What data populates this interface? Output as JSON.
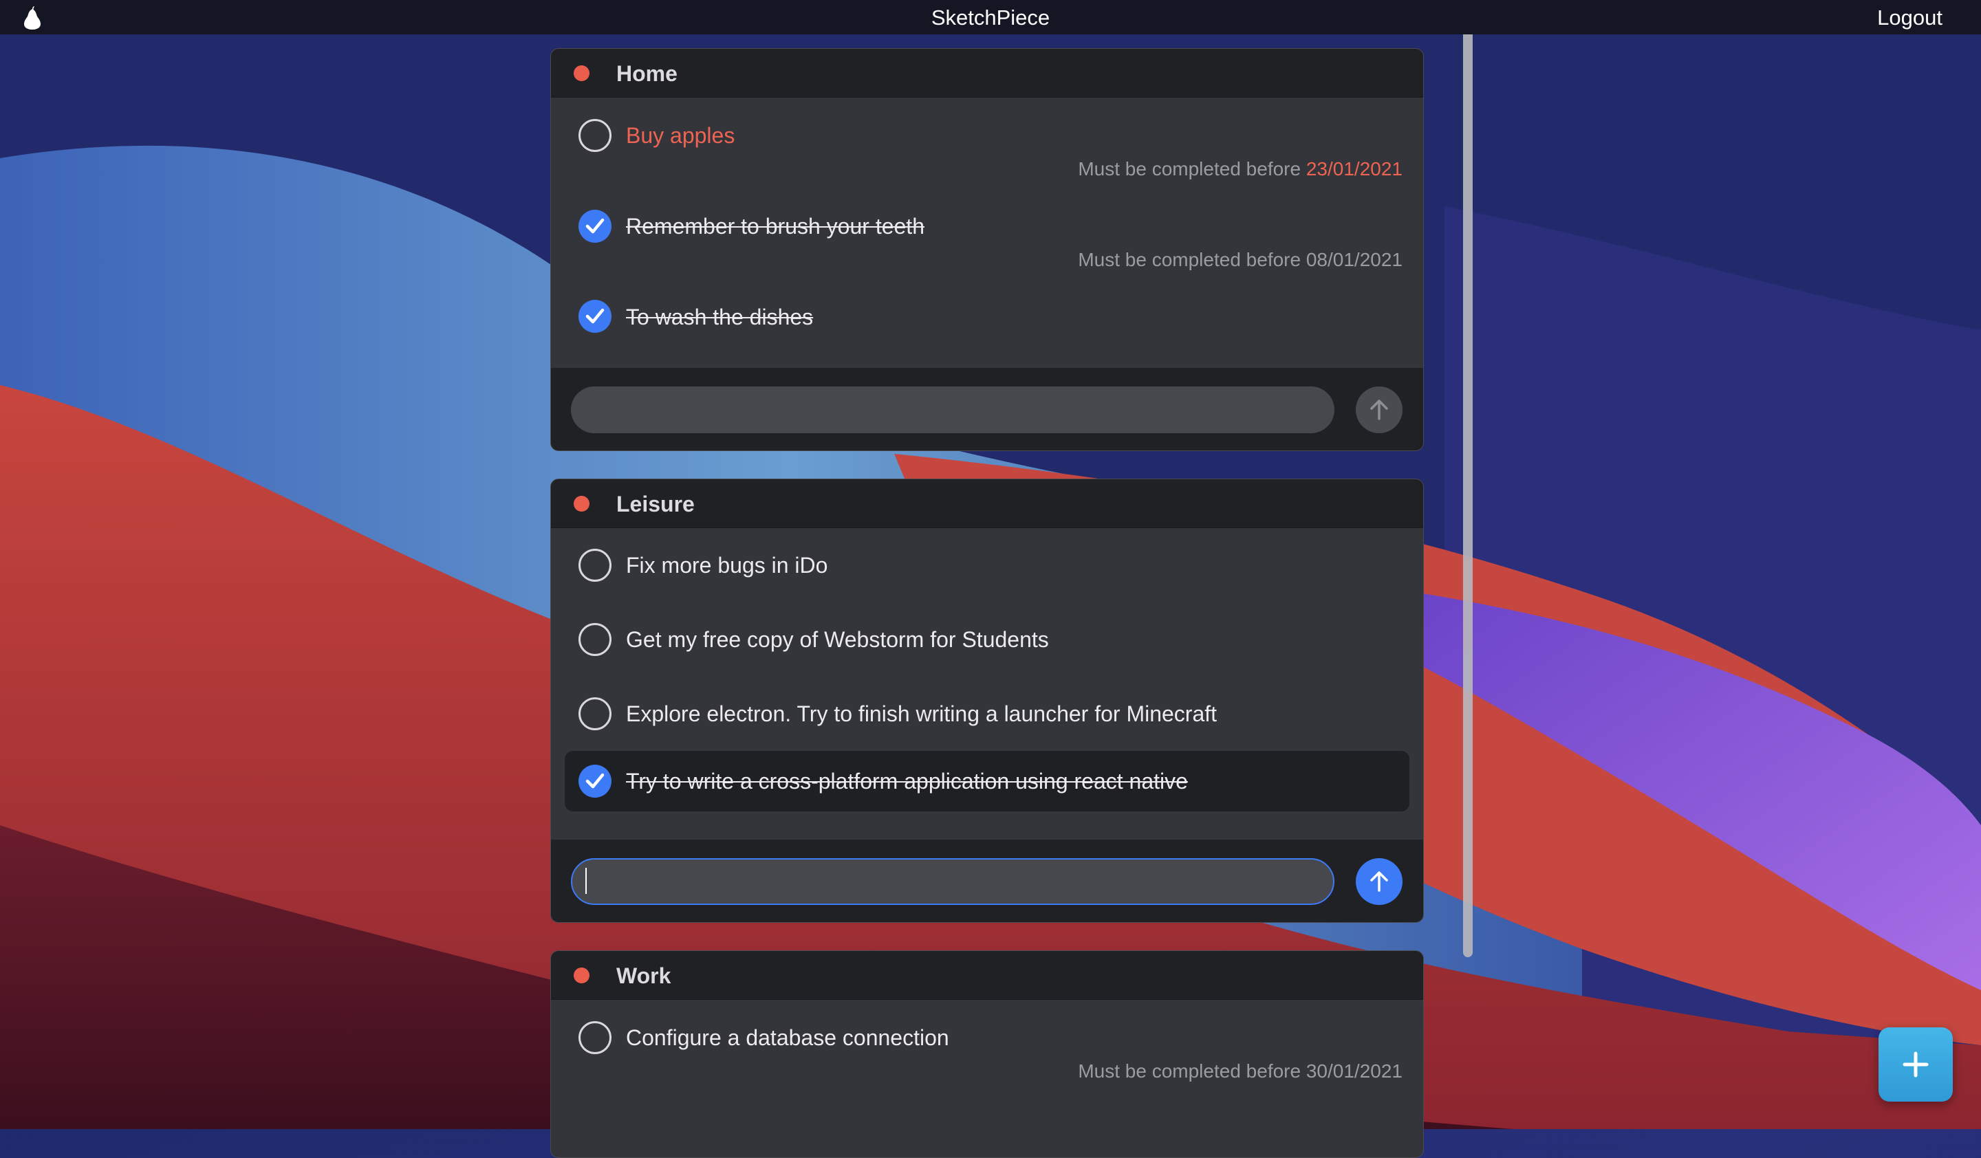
{
  "menubar": {
    "app_icon": "pear-logo-icon",
    "title": "SketchPiece",
    "logout_label": "Logout"
  },
  "lists": [
    {
      "title": "Home",
      "dot_color": "#eb5e4c",
      "tasks": [
        {
          "label": "Buy apples",
          "done": false,
          "overdue": true,
          "due_prefix": "Must be completed before",
          "due_date": "23/01/2021"
        },
        {
          "label": "Remember to brush your teeth",
          "done": true,
          "overdue": false,
          "due_prefix": "Must be completed before",
          "due_date": "08/01/2021"
        },
        {
          "label": "To wash the dishes",
          "done": true,
          "overdue": false
        }
      ],
      "composer": {
        "value": "",
        "focused": false
      }
    },
    {
      "title": "Leisure",
      "dot_color": "#eb5e4c",
      "tasks": [
        {
          "label": "Fix more bugs in iDo",
          "done": false
        },
        {
          "label": "Get my free copy of Webstorm for Students",
          "done": false
        },
        {
          "label": "Explore electron. Try to finish writing a launcher for Minecraft",
          "done": false
        },
        {
          "label": "Try to write a cross-platform application using react native",
          "done": true,
          "highlighted": true
        }
      ],
      "composer": {
        "value": "",
        "focused": true
      }
    },
    {
      "title": "Work",
      "dot_color": "#eb5e4c",
      "tasks": [
        {
          "label": "Configure a database connection",
          "done": false,
          "due_prefix": "Must be completed before",
          "due_date": "30/01/2021"
        }
      ]
    }
  ],
  "icons": {
    "check": "checkmark-icon",
    "send": "arrow-up-icon",
    "fab": "plus-icon"
  },
  "colors": {
    "accent": "#3d7bf6",
    "overdue": "#ef6352",
    "fab": "#3aa7e0"
  }
}
